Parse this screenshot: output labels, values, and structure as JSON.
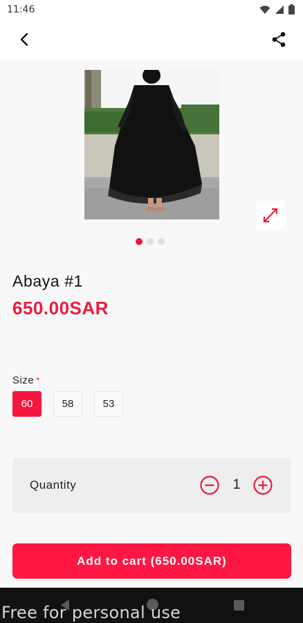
{
  "status": {
    "time": "11:46"
  },
  "product": {
    "name": "Abaya #1",
    "price": "650.00SAR",
    "image_count": 3,
    "active_image": 1
  },
  "size": {
    "label": "Size",
    "required_mark": "*",
    "options": [
      "60",
      "58",
      "53"
    ],
    "selected": "60"
  },
  "quantity": {
    "label": "Quantity",
    "value": "1"
  },
  "cart": {
    "button_label": "Add to cart (650.00SAR)"
  },
  "watermark": "Free for personal use",
  "colors": {
    "accent": "#ff1744",
    "price": "#ea1b3d",
    "background": "#f8f8f8"
  },
  "icons": [
    "back-arrow-icon",
    "share-icon",
    "expand-icon",
    "minus-circle-icon",
    "plus-circle-icon",
    "wifi-icon",
    "signal-icon",
    "battery-icon"
  ]
}
